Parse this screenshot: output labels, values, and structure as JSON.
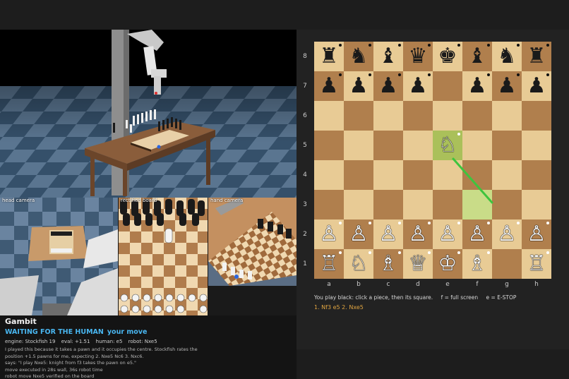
{
  "cameras": {
    "head_label": "head camera",
    "rect_label": "rectified board",
    "hand_label": "hand camera"
  },
  "info": {
    "title": "Gambit",
    "status": "WAITING FOR THE HUMAN",
    "status_sub": "your move",
    "engine": "engine: Stockfish 19",
    "eval": "eval: +1.51",
    "human": "human: e5",
    "robot": "robot: Nxe5",
    "explanation": "I played this because it takes a pawn and it occupies the centre. Stockfish rates the position +1.5 pawns for me, expecting 2. Nxe5 Nc6 3. Nxc6.",
    "says": "says: \"I play Nxe5: knight from f3 takes the pawn on e5.\"",
    "executed": "move executed in 28s wall, 36s robot time",
    "verified": "robot move Nxe5 verified on the board"
  },
  "board": {
    "files": [
      "a",
      "b",
      "c",
      "d",
      "e",
      "f",
      "g",
      "h"
    ],
    "ranks": [
      "8",
      "7",
      "6",
      "5",
      "4",
      "3",
      "2",
      "1"
    ],
    "highlight_to": "e5",
    "highlight_from": "f3",
    "pieces": {
      "a8": "♜",
      "b8": "♞",
      "c8": "♝",
      "d8": "♛",
      "e8": "♚",
      "f8": "♝",
      "g8": "♞",
      "h8": "♜",
      "a7": "♟",
      "b7": "♟",
      "c7": "♟",
      "d7": "♟",
      "f7": "♟",
      "g7": "♟",
      "h7": "♟",
      "e5": "♘",
      "a2": "♙",
      "b2": "♙",
      "c2": "♙",
      "d2": "♙",
      "e2": "♙",
      "f2": "♙",
      "g2": "♙",
      "h2": "♙",
      "a1": "♖",
      "b1": "♘",
      "c1": "♗",
      "d1": "♕",
      "e1": "♔",
      "f1": "♗",
      "h1": "♖"
    },
    "black_dots": [
      "a8",
      "b8",
      "c8",
      "d8",
      "e8",
      "f8",
      "g8",
      "h8",
      "a7",
      "b7",
      "c7",
      "d7",
      "f7",
      "g7",
      "h7"
    ],
    "white_dots": [
      "e5",
      "a2",
      "b2",
      "c2",
      "d2",
      "e2",
      "f2",
      "g2",
      "h2",
      "a1",
      "b1",
      "c1",
      "d1",
      "e1",
      "f1",
      "h1"
    ]
  },
  "hints": {
    "play": "You play black: click a piece, then its square.",
    "fullscreen": "f = full screen",
    "estop": "e = E-STOP"
  },
  "moves": "1. Nf3 e5 2. Nxe5",
  "colors": {
    "status_blue": "#49b6f0",
    "moves_orange": "#e0a440",
    "arrow_green": "#3ec43e",
    "square_light": "#e8cb95",
    "square_dark": "#b07f4d"
  }
}
